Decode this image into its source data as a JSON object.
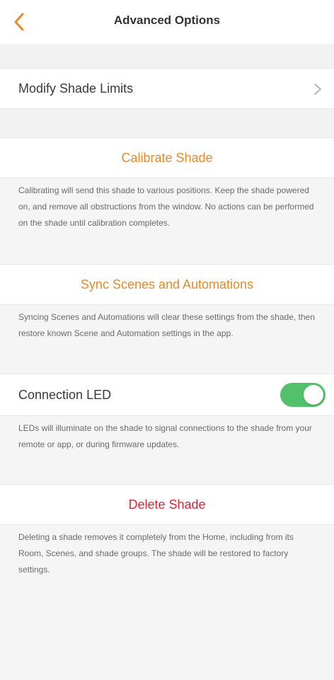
{
  "header": {
    "title": "Advanced Options",
    "back_icon": "chevron-left-icon"
  },
  "colors": {
    "accent_orange": "#e7892b",
    "danger_red": "#d6283b",
    "toggle_green": "#52c16a"
  },
  "modify_limits": {
    "label": "Modify Shade Limits",
    "icon": "chevron-right-icon"
  },
  "calibrate": {
    "label": "Calibrate Shade",
    "description": "Calibrating will send this shade to various positions. Keep the shade powered on, and remove all obstructions from the window. No actions can be performed on the shade until calibration completes."
  },
  "sync": {
    "label": "Sync Scenes and Automations",
    "description": "Syncing Scenes and Automations will clear these settings from the shade, then restore known Scene and Automation settings in the app."
  },
  "led": {
    "label": "Connection LED",
    "enabled": true,
    "description": "LEDs will illuminate on the shade to signal connections to the shade from your remote or app, or during firmware updates."
  },
  "delete": {
    "label": "Delete Shade",
    "description": "Deleting a shade removes it completely from the Home, including from its Room, Scenes, and shade groups. The shade will be restored to factory settings."
  }
}
